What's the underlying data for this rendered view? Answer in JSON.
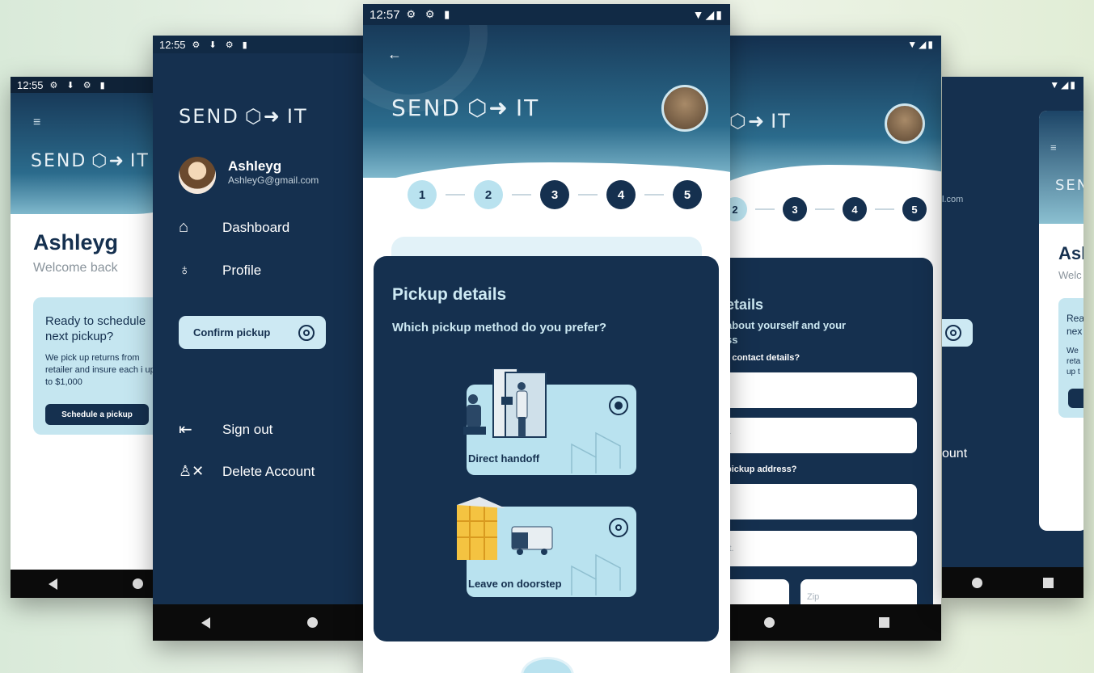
{
  "brand": {
    "logo_left": "SEND",
    "logo_right": "IT"
  },
  "colors": {
    "navy": "#15304f",
    "light_blue": "#b9e2ef",
    "accent": "#7fb8cc"
  },
  "screen_home": {
    "time": "12:55",
    "greeting_name": "Ashleyg",
    "greeting_sub": "Welcome back",
    "card_title": "Ready to schedule next pickup?",
    "card_body": "We pick up returns from retailer and insure each i up to $1,000",
    "card_button": "Schedule a pickup"
  },
  "screen_menu": {
    "time": "12:55",
    "user_name": "Ashleyg",
    "user_email": "AshleyG@gmail.com",
    "items": [
      {
        "label": "Dashboard",
        "icon": "home-icon"
      },
      {
        "label": "Profile",
        "icon": "user-icon"
      }
    ],
    "confirm_label": "Confirm pickup",
    "bottom_items": [
      {
        "label": "Sign out",
        "icon": "sign-out-icon"
      },
      {
        "label": "Delete Account",
        "icon": "delete-user-icon"
      }
    ]
  },
  "screen_pickup": {
    "time": "12:57",
    "steps": [
      "1",
      "2",
      "3",
      "4",
      "5"
    ],
    "title": "Pickup details",
    "question": "Which pickup method do you prefer?",
    "options": [
      {
        "label": "Direct handoff",
        "selected": true
      },
      {
        "label": "Leave on doorstep",
        "selected": false
      }
    ]
  },
  "screen_contact": {
    "steps": [
      "2",
      "3",
      "4",
      "5"
    ],
    "title": "etails",
    "subtitle": "about yourself and your",
    "subtitle2": "ss",
    "contact_label": "r contact details?",
    "address_label": "pickup address?",
    "placeholders": [
      "",
      "ber",
      "ss",
      "Apt.",
      "",
      "Zip"
    ]
  },
  "screen_right": {
    "logo_fragment": "SEN",
    "name_fragment": "Asl",
    "sub_fragment": "Welc",
    "card_fragments": [
      "Rea",
      "nex",
      "We",
      "reta",
      "up t"
    ],
    "email_fragment": "l.com",
    "account_fragment": "ount"
  }
}
